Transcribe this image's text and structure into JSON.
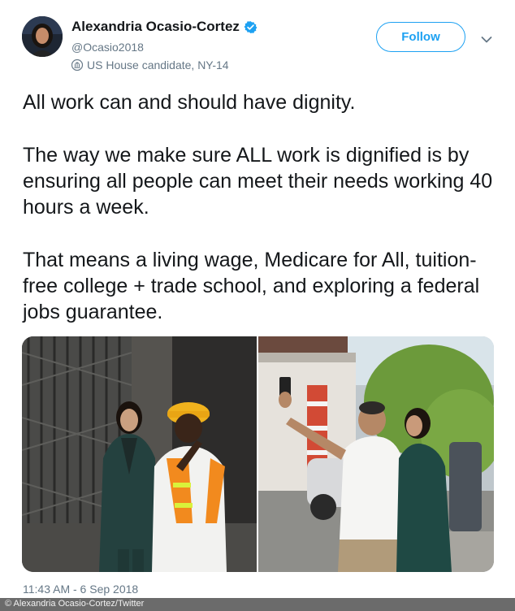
{
  "author": {
    "display_name": "Alexandria Ocasio-Cortez",
    "handle": "@Ocasio2018",
    "location": "US House candidate, NY-14",
    "verified_icon": "verified-badge-icon",
    "location_icon": "government-building-icon"
  },
  "header": {
    "follow_label": "Follow",
    "menu_icon": "chevron-down-icon"
  },
  "tweet": {
    "paragraphs": [
      "All work can and should have dignity.",
      "The way we make sure ALL work is dignified is by ensuring all people can meet their needs working 40 hours a week.",
      "That means a living wage, Medicare for All, tuition-free college + trade school, and exploring a federal jobs guarantee."
    ]
  },
  "media": {
    "photo_count": 2
  },
  "footer": {
    "timestamp": "11:43 AM - 6 Sep 2018",
    "credit": "© Alexandria Ocasio-Cortez/Twitter"
  },
  "colors": {
    "accent": "#1da1f2",
    "text": "#14171a",
    "muted": "#657786"
  }
}
